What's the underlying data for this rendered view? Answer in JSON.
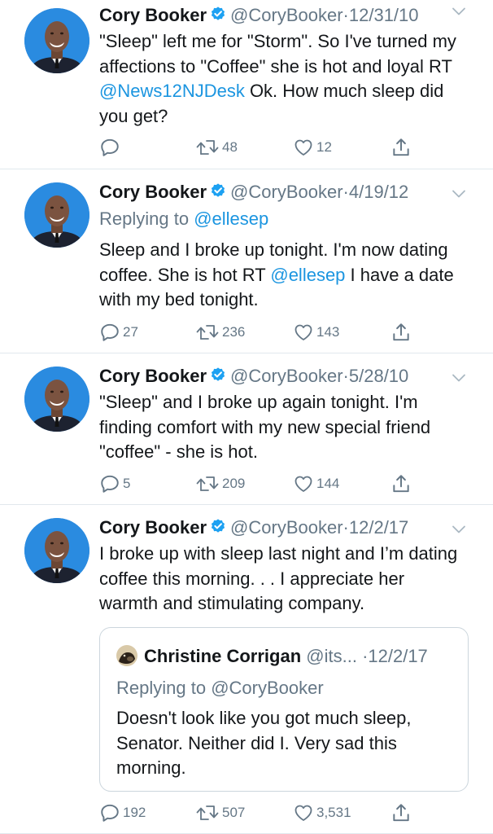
{
  "tweets": [
    {
      "name": "Cory Booker",
      "handle": "@CoryBooker",
      "date": "12/31/10",
      "text_before": "\"Sleep\" left me for \"Storm\". So I've turned my affections to \"Coffee\" she is hot and loyal RT ",
      "mention": "@News12NJDesk",
      "text_after": " Ok. How much sleep did you get?",
      "reply_count": "",
      "retweet_count": "48",
      "like_count": "12"
    },
    {
      "name": "Cory Booker",
      "handle": "@CoryBooker",
      "date": "4/19/12",
      "replying_label": "Replying to ",
      "replying_handle": "@ellesep",
      "text_before": "Sleep and I broke up tonight. I'm now dating coffee.  She is hot RT ",
      "mention": "@ellesep",
      "text_after": "  I have a date with my bed tonight.",
      "reply_count": "27",
      "retweet_count": "236",
      "like_count": "143"
    },
    {
      "name": "Cory Booker",
      "handle": "@CoryBooker",
      "date": "5/28/10",
      "text": "\"Sleep\" and I broke up again tonight. I'm finding comfort with my new special friend \"coffee\" - she is hot.",
      "reply_count": "5",
      "retweet_count": "209",
      "like_count": "144"
    },
    {
      "name": "Cory Booker",
      "handle": "@CoryBooker",
      "date": "12/2/17",
      "text": "I broke up with sleep last night and I’m dating coffee this morning. . . I appreciate her warmth and stimulating company.",
      "quote": {
        "name": "Christine Corrigan",
        "handle": "@its...",
        "date": "12/2/17",
        "replying_label": "Replying to ",
        "replying_handle": "@CoryBooker",
        "text": "Doesn't look like you got much sleep, Senator.  Neither did I.  Very sad this morning."
      },
      "reply_count": "192",
      "retweet_count": "507",
      "like_count": "3,531"
    }
  ],
  "separator_dot": "·",
  "colors": {
    "link": "#1b95e0",
    "muted": "#657786",
    "verified": "#1da1f2",
    "border": "#e1e8ed"
  },
  "icons": {
    "reply": "reply-icon",
    "retweet": "retweet-icon",
    "like": "heart-icon",
    "share": "share-icon",
    "verified": "verified-badge-icon",
    "caret": "chevron-down-icon"
  }
}
